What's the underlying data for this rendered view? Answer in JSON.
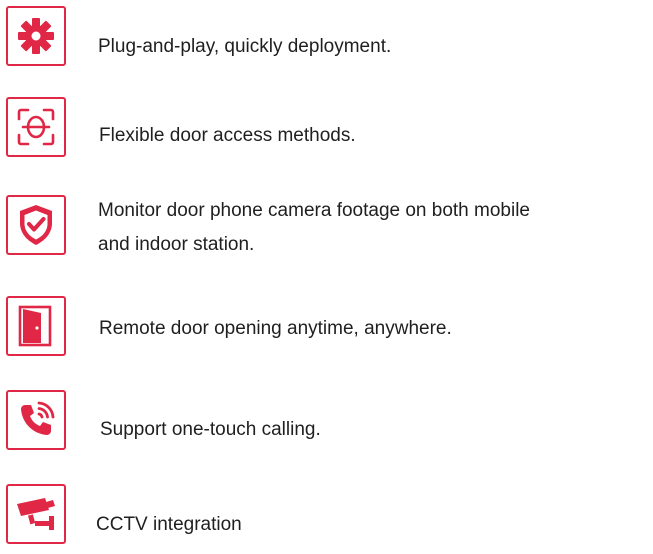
{
  "accent_color": "#e02746",
  "features": [
    {
      "icon": "gear-icon",
      "text": "Plug-and-play, quickly deployment."
    },
    {
      "icon": "face-scan-icon",
      "text": "Flexible door access methods."
    },
    {
      "icon": "shield-check-icon",
      "lines": [
        "Monitor door phone camera footage on both mobile",
        "and indoor station."
      ]
    },
    {
      "icon": "door-open-icon",
      "text": "Remote door opening anytime, anywhere."
    },
    {
      "icon": "phone-call-icon",
      "text": "Support one-touch calling."
    },
    {
      "icon": "cctv-camera-icon",
      "text": "CCTV integration"
    }
  ]
}
